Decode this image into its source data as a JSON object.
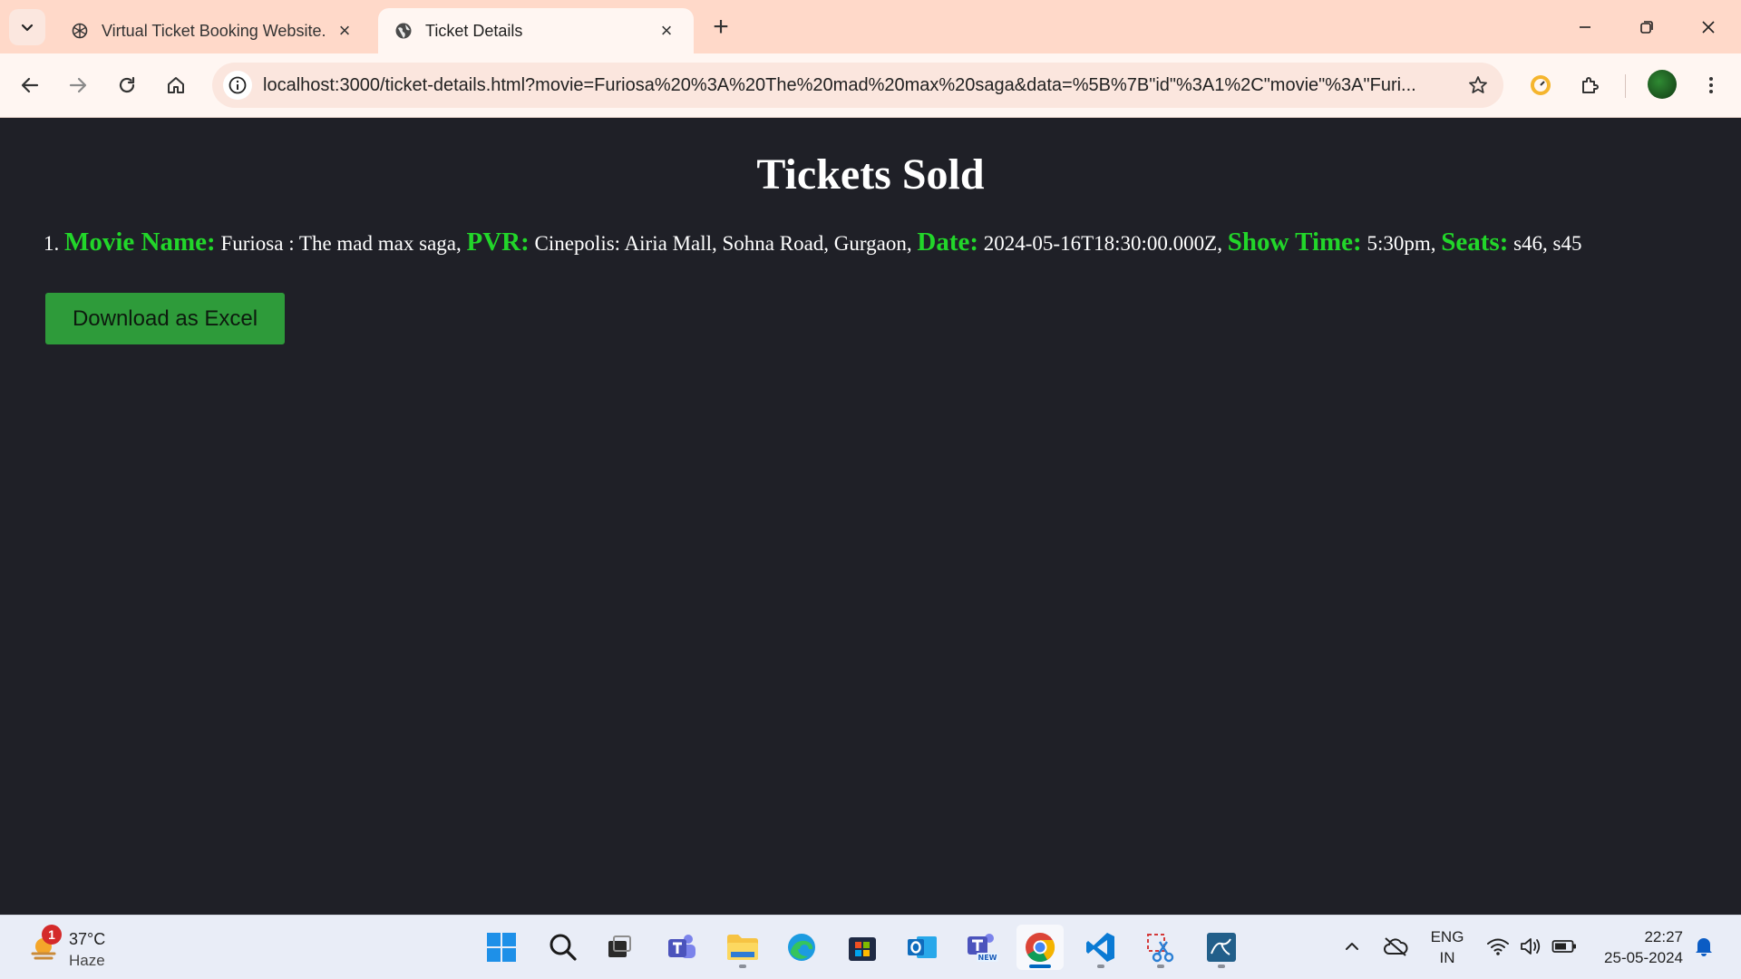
{
  "browser": {
    "tabs": [
      {
        "title": "Virtual Ticket Booking Website.",
        "active": false
      },
      {
        "title": "Ticket Details",
        "active": true
      }
    ],
    "url": "localhost:3000/ticket-details.html?movie=Furiosa%20%3A%20The%20mad%20max%20saga&data=%5B%7B\"id\"%3A1%2C\"movie\"%3A\"Furi..."
  },
  "page": {
    "heading": "Tickets Sold",
    "tickets": [
      {
        "number": "1.",
        "movie_label": "Movie Name:",
        "movie": "Furiosa : The mad max saga,",
        "pvr_label": "PVR:",
        "pvr": "Cinepolis: Airia Mall, Sohna Road, Gurgaon,",
        "date_label": "Date:",
        "date": "2024-05-16T18:30:00.000Z,",
        "showtime_label": "Show Time:",
        "showtime": "5:30pm,",
        "seats_label": "Seats:",
        "seats": "s46, s45"
      }
    ],
    "download_button": "Download as Excel"
  },
  "taskbar": {
    "weather": {
      "badge": "1",
      "temp": "37°C",
      "condition": "Haze"
    },
    "apps": [
      "start-icon",
      "search-icon",
      "task-view-icon",
      "teams-icon",
      "file-explorer-icon",
      "edge-icon",
      "store-icon",
      "outlook-icon",
      "teams-new-icon",
      "chrome-icon",
      "vscode-icon",
      "snipping-tool-icon",
      "mysql-workbench-icon"
    ],
    "language": {
      "line1": "ENG",
      "line2": "IN"
    },
    "clock": {
      "time": "22:27",
      "date": "25-05-2024"
    }
  },
  "colors": {
    "page_bg": "#1f2027",
    "label_green": "#22d62a",
    "button_green": "#2e9b3a",
    "tabstrip_bg": "#ffd9c9"
  }
}
